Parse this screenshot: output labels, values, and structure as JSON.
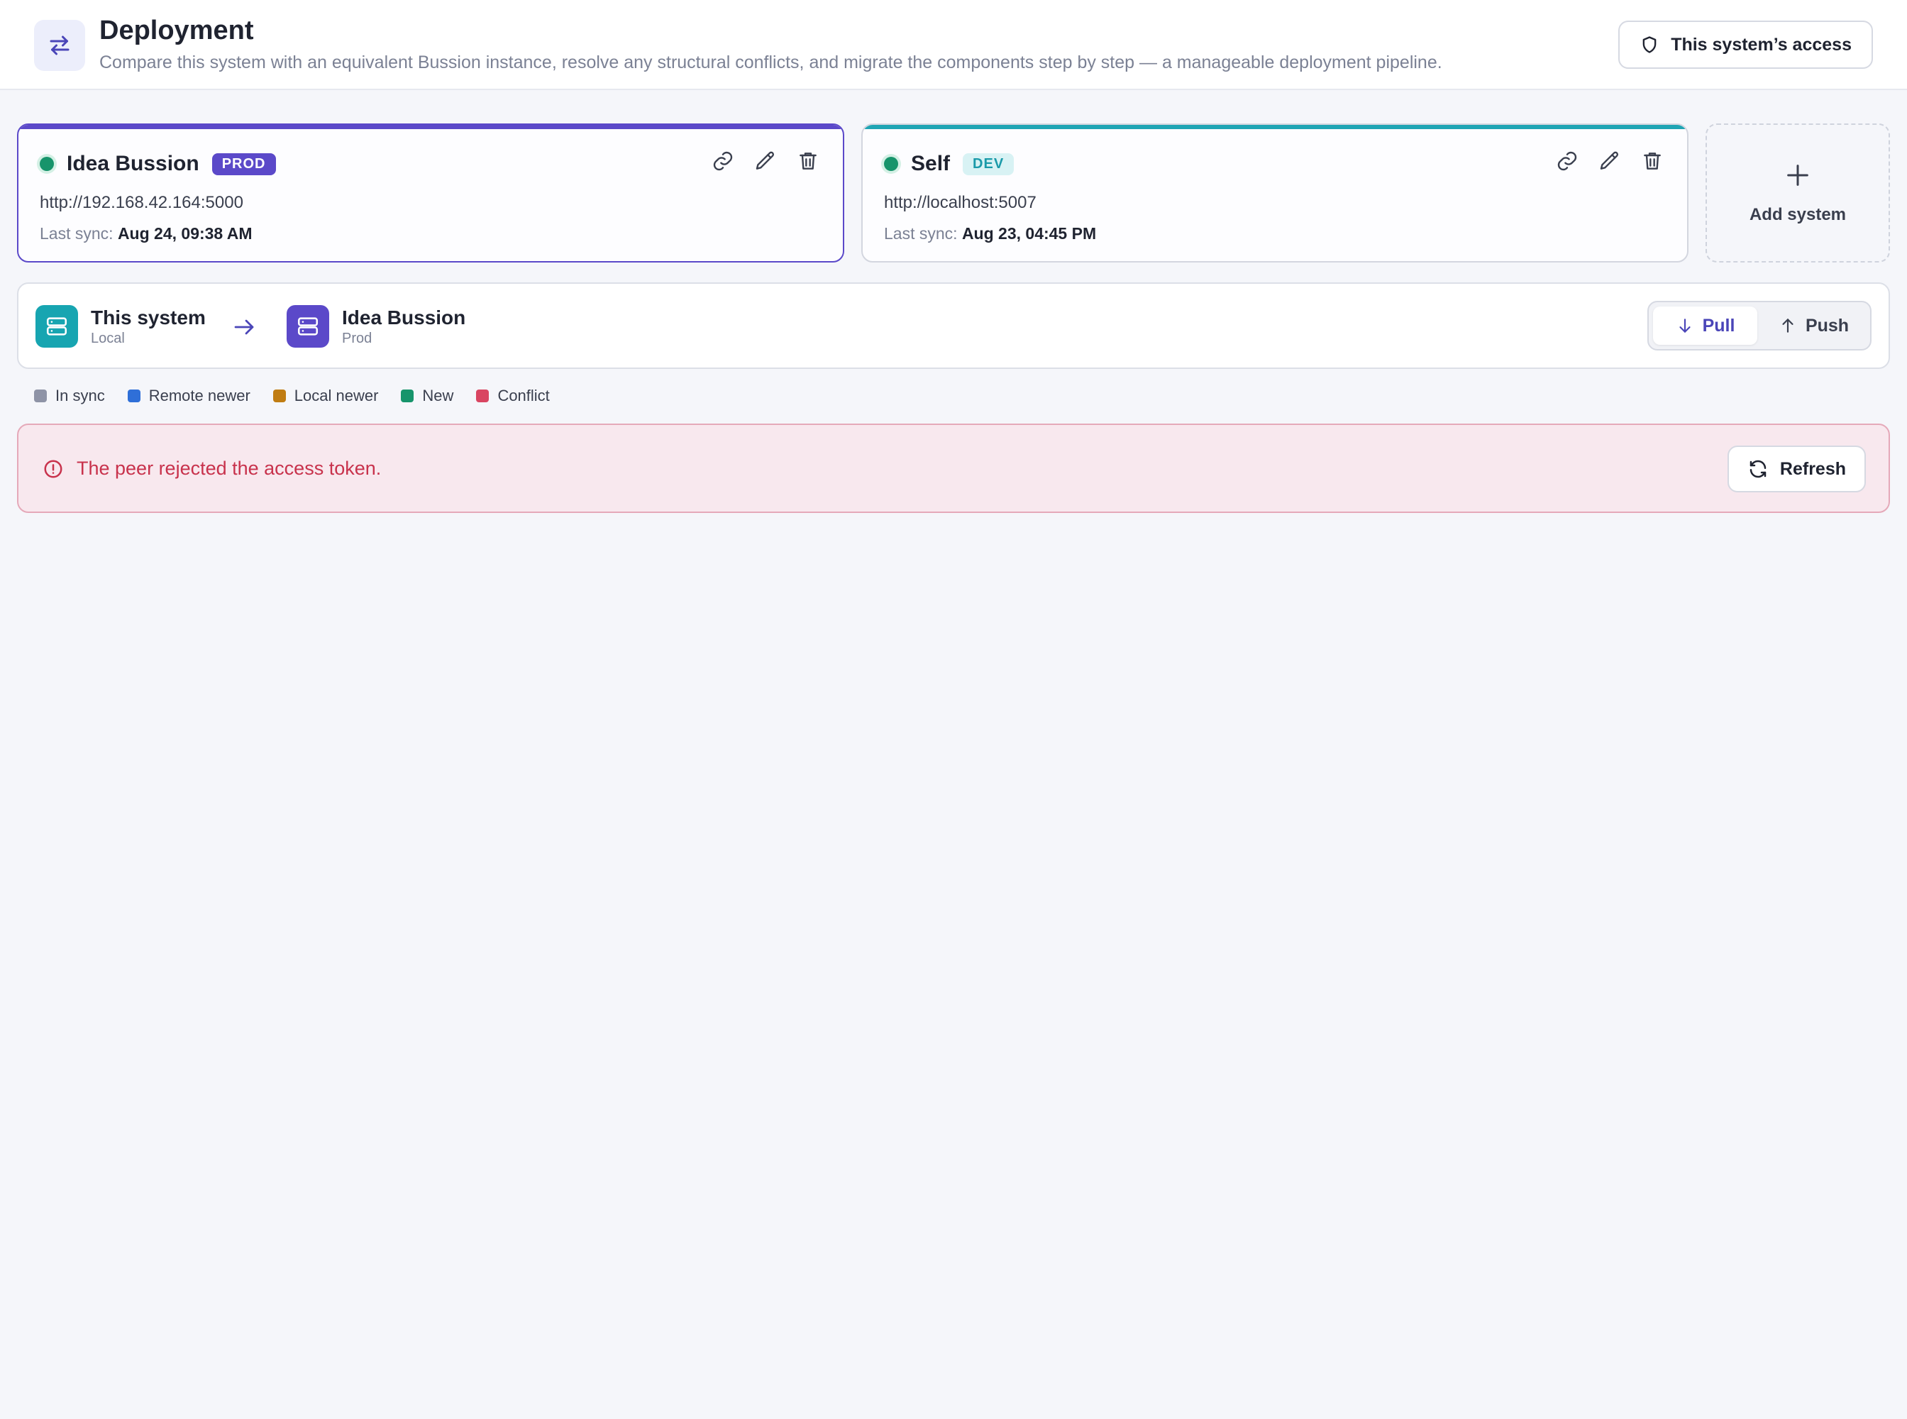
{
  "header": {
    "title": "Deployment",
    "subtitle": "Compare this system with an equivalent Bussion instance, resolve any structural conflicts, and migrate the components step by step — a manageable deployment pipeline.",
    "access_button": "This system’s access",
    "icon": "swap-arrows-icon"
  },
  "systems": [
    {
      "name": "Idea Bussion",
      "badge": "PROD",
      "url": "http://192.168.42.164:5000",
      "last_sync_label": "Last sync:",
      "last_sync_value": "Aug 24, 09:38 AM",
      "status": "online",
      "accent": "#5b49c9",
      "selected": true
    },
    {
      "name": "Self",
      "badge": "DEV",
      "url": "http://localhost:5007",
      "last_sync_label": "Last sync:",
      "last_sync_value": "Aug 23, 04:45 PM",
      "status": "online",
      "accent": "#1fa5b4",
      "selected": false
    }
  ],
  "add_system": {
    "label": "Add system"
  },
  "direction": {
    "source": {
      "title": "This system",
      "subtitle": "Local"
    },
    "target": {
      "title": "Idea Bussion",
      "subtitle": "Prod"
    },
    "pull_label": "Pull",
    "push_label": "Push",
    "active_mode": "pull"
  },
  "legend": [
    {
      "label": "In sync",
      "color": "#8e93a6"
    },
    {
      "label": "Remote newer",
      "color": "#2f6fd8"
    },
    {
      "label": "Local newer",
      "color": "#c07c12"
    },
    {
      "label": "New",
      "color": "#17946b"
    },
    {
      "label": "Conflict",
      "color": "#d94561"
    }
  ],
  "error": {
    "message": "The peer rejected the access token.",
    "refresh_label": "Refresh"
  }
}
